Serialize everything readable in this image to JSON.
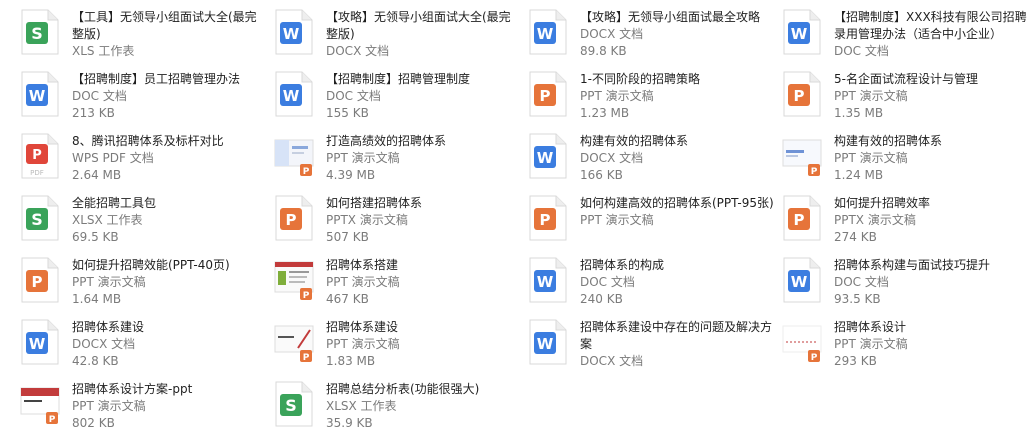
{
  "files": [
    {
      "name": "【工具】无领导小组面试大全(最完整版)",
      "type": "XLS 工作表",
      "size": "",
      "icon": "spreadsheet-icon"
    },
    {
      "name": "【攻略】无领导小组面试大全(最完整版)",
      "type": "DOCX 文档",
      "size": "",
      "icon": "word-doc-icon"
    },
    {
      "name": "【攻略】无领导小组面试最全攻略",
      "type": "DOCX 文档",
      "size": "89.8 KB",
      "icon": "word-doc-icon"
    },
    {
      "name": "【招聘制度】XXX科技有限公司招聘录用管理办法（适合中小企业）",
      "type": "DOC 文档",
      "size": "",
      "icon": "word-doc-icon"
    },
    {
      "name": "【招聘制度】员工招聘管理办法",
      "type": "DOC 文档",
      "size": "213 KB",
      "icon": "word-doc-icon"
    },
    {
      "name": "【招聘制度】招聘管理制度",
      "type": "DOC 文档",
      "size": "155 KB",
      "icon": "word-doc-icon"
    },
    {
      "name": "1-不同阶段的招聘策略",
      "type": "PPT 演示文稿",
      "size": "1.23 MB",
      "icon": "presentation-icon"
    },
    {
      "name": "5-名企面试流程设计与管理",
      "type": "PPT 演示文稿",
      "size": "1.35 MB",
      "icon": "presentation-icon"
    },
    {
      "name": "8、腾讯招聘体系及标杆对比",
      "type": "WPS PDF 文档",
      "size": "2.64 MB",
      "icon": "pdf-icon"
    },
    {
      "name": "打造高绩效的招聘体系",
      "type": "PPT 演示文稿",
      "size": "4.39 MB",
      "icon": "ppt-thumbnail-icon"
    },
    {
      "name": "构建有效的招聘体系",
      "type": "DOCX 文档",
      "size": "166 KB",
      "icon": "word-doc-icon"
    },
    {
      "name": "构建有效的招聘体系",
      "type": "PPT 演示文稿",
      "size": "1.24 MB",
      "icon": "ppt-thumbnail-icon"
    },
    {
      "name": "全能招聘工具包",
      "type": "XLSX 工作表",
      "size": "69.5 KB",
      "icon": "spreadsheet-icon"
    },
    {
      "name": "如何搭建招聘体系",
      "type": "PPTX 演示文稿",
      "size": "507 KB",
      "icon": "presentation-icon"
    },
    {
      "name": "如何构建高效的招聘体系(PPT-95张)",
      "type": "PPT 演示文稿",
      "size": "",
      "icon": "presentation-icon"
    },
    {
      "name": "如何提升招聘效率",
      "type": "PPTX 演示文稿",
      "size": "274 KB",
      "icon": "presentation-icon"
    },
    {
      "name": "如何提升招聘效能(PPT-40页)",
      "type": "PPT 演示文稿",
      "size": "1.64 MB",
      "icon": "presentation-icon"
    },
    {
      "name": "招聘体系搭建",
      "type": "PPT 演示文稿",
      "size": "467 KB",
      "icon": "ppt-thumbnail-icon"
    },
    {
      "name": "招聘体系的构成",
      "type": "DOC 文档",
      "size": "240 KB",
      "icon": "word-doc-icon"
    },
    {
      "name": "招聘体系构建与面试技巧提升",
      "type": "DOC 文档",
      "size": "93.5 KB",
      "icon": "word-doc-icon"
    },
    {
      "name": "招聘体系建设",
      "type": "DOCX 文档",
      "size": "42.8 KB",
      "icon": "word-doc-icon"
    },
    {
      "name": "招聘体系建设",
      "type": "PPT 演示文稿",
      "size": "1.83 MB",
      "icon": "ppt-thumbnail-icon"
    },
    {
      "name": "招聘体系建设中存在的问题及解决方案",
      "type": "DOCX 文档",
      "size": "",
      "icon": "word-doc-icon"
    },
    {
      "name": "招聘体系设计",
      "type": "PPT 演示文稿",
      "size": "293 KB",
      "icon": "ppt-thumbnail-icon"
    },
    {
      "name": "招聘体系设计方案-ppt",
      "type": "PPT 演示文稿",
      "size": "802 KB",
      "icon": "ppt-thumbnail-icon"
    },
    {
      "name": "招聘总结分析表(功能很强大)",
      "type": "XLSX 工作表",
      "size": "35.9 KB",
      "icon": "spreadsheet-icon"
    }
  ],
  "colors": {
    "spreadsheet": "#3aa35a",
    "word": "#3b7de0",
    "presentation": "#e6743a",
    "pdf": "#e0463a"
  }
}
